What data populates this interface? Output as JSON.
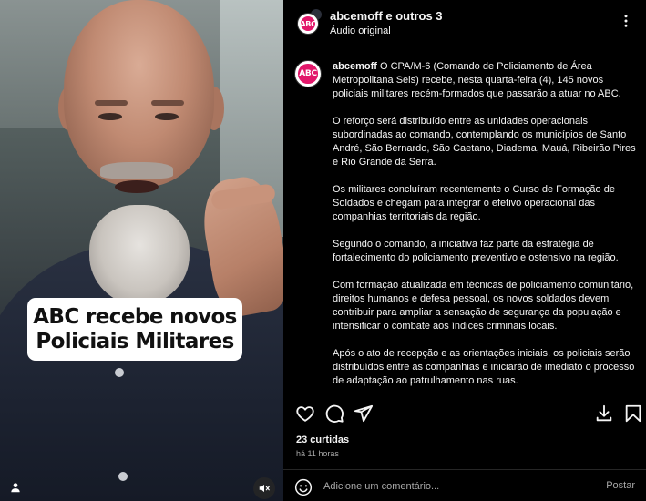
{
  "video": {
    "caption_line1": "ABC recebe novos",
    "caption_line2": "Policiais Militares",
    "mute_icon": "speaker-muted-icon",
    "user_icon": "person-icon"
  },
  "header": {
    "avatar_text": "ABC",
    "names": "abcemoff e outros 3",
    "subtitle": "Áudio original",
    "more_icon": "more-vertical-icon"
  },
  "post": {
    "avatar_text": "ABC",
    "username": "abcemoff",
    "paragraphs": [
      "O CPA/M-6 (Comando de Policiamento de Área Metropolitana Seis) recebe, nesta quarta-feira (4), 145 novos policiais militares recém-formados que passarão a atuar no ABC.",
      "O reforço será distribuído entre as unidades operacionais subordinadas ao comando, contemplando os municípios de Santo André, São Bernardo, São Caetano, Diadema, Mauá, Ribeirão Pires e Rio Grande da Serra.",
      "Os militares concluíram recentemente o Curso de Formação de Soldados e chegam para integrar o efetivo operacional das companhias territoriais da região.",
      "Segundo o comando, a iniciativa faz parte da estratégia de fortalecimento do policiamento preventivo e ostensivo na região.",
      "Com formação atualizada em técnicas de policiamento comunitário, direitos humanos e defesa pessoal, os novos soldados devem contribuir para ampliar a sensação de segurança da população e intensificar o combate aos índices criminais locais.",
      "Após o ato de recepção e as orientações iniciais, os policiais serão distribuídos entre as companhias e iniciarão de imediato o processo de adaptação ao patrulhamento nas ruas."
    ]
  },
  "actions": {
    "icons": [
      "heart-icon",
      "comment-icon",
      "share-icon",
      "download-icon",
      "bookmark-icon"
    ],
    "likes": "23 curtidas",
    "time": "há 11 horas"
  },
  "comment": {
    "placeholder": "Adicione um comentário...",
    "post_label": "Postar",
    "emoji_icon": "smiley-icon"
  },
  "colors": {
    "background": "#000000",
    "text": "#f5f5f5",
    "muted": "#a8a8a8",
    "brand": "#e2176a",
    "divider": "#262626"
  }
}
